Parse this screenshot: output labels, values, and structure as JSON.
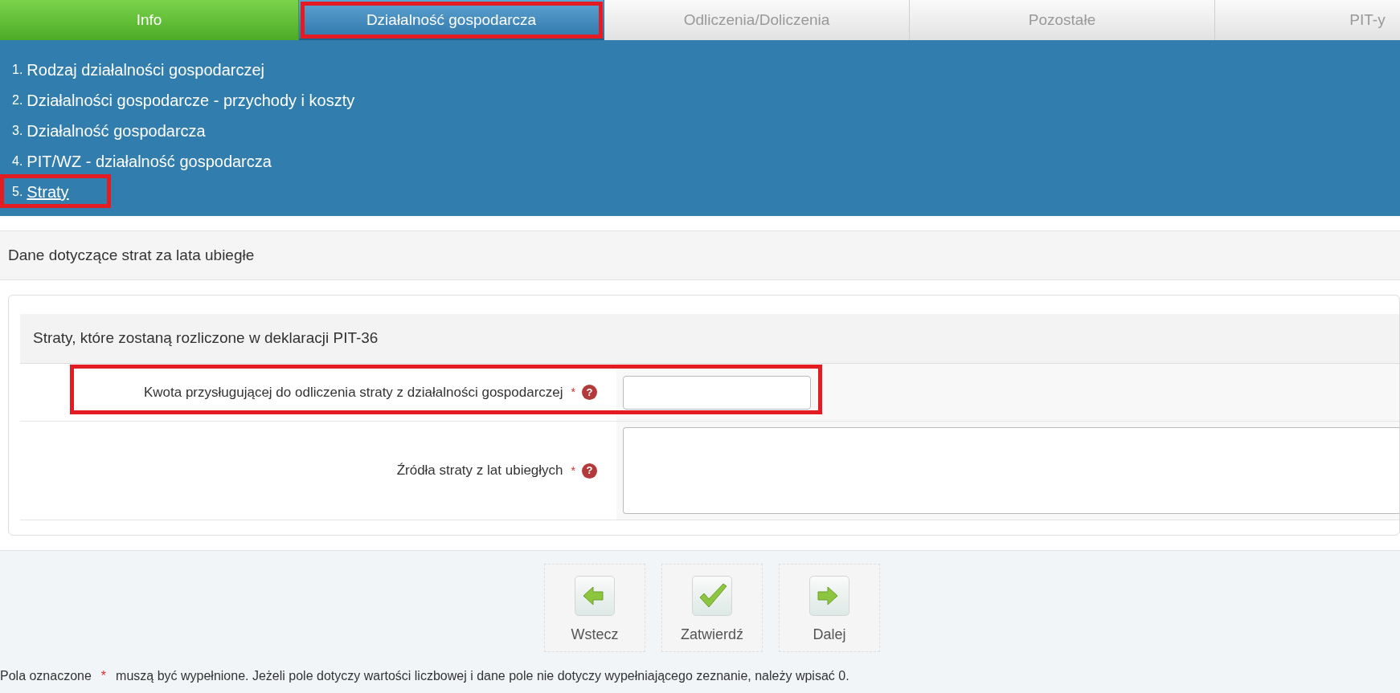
{
  "tabs": [
    {
      "label": "Info",
      "selected": false,
      "completed": true,
      "highlighted": false
    },
    {
      "label": "Działalność gospodarcza",
      "selected": true,
      "completed": false,
      "highlighted": true
    },
    {
      "label": "Odliczenia/Doliczenia",
      "selected": false,
      "completed": false,
      "highlighted": false
    },
    {
      "label": "Pozostałe",
      "selected": false,
      "completed": false,
      "highlighted": false
    },
    {
      "label": "PIT-y",
      "selected": false,
      "completed": false,
      "highlighted": false
    }
  ],
  "steps": [
    {
      "number": "1.",
      "label": "Rodzaj działalności gospodarczej",
      "selected": false,
      "highlighted": false
    },
    {
      "number": "2.",
      "label": "Działalności gospodarcze - przychody i koszty",
      "selected": false,
      "highlighted": false
    },
    {
      "number": "3.",
      "label": "Działalność gospodarcza",
      "selected": false,
      "highlighted": false
    },
    {
      "number": "4.",
      "label": "PIT/WZ - działalność gospodarcza",
      "selected": false,
      "highlighted": false
    },
    {
      "number": "5.",
      "label": "Straty",
      "selected": true,
      "highlighted": true
    }
  ],
  "section_title": "Dane dotyczące strat za lata ubiegłe",
  "panel": {
    "title": "Straty, które zostaną rozliczone w deklaracji PIT-36",
    "fields": [
      {
        "kind": "input",
        "label": "Kwota przysługującej do odliczenia straty z działalności gospodarczej",
        "required_mark": "*",
        "help_icon": "?",
        "highlighted": true
      },
      {
        "kind": "textarea",
        "label": "Źródła straty z lat ubiegłych",
        "required_mark": "*",
        "help_icon": "?",
        "highlighted": false
      }
    ]
  },
  "buttons": [
    {
      "kind": "back",
      "label": "Wstecz"
    },
    {
      "kind": "confirm",
      "label": "Zatwierdź"
    },
    {
      "kind": "next",
      "label": "Dalej"
    }
  ],
  "footnote": {
    "before": "Pola oznaczone",
    "mark": "*",
    "after": "muszą być wypełnione. Jeżeli pole dotyczy wartości liczbowej i dane pole nie dotyczy wypełniającego zeznanie, należy wpisać 0."
  }
}
